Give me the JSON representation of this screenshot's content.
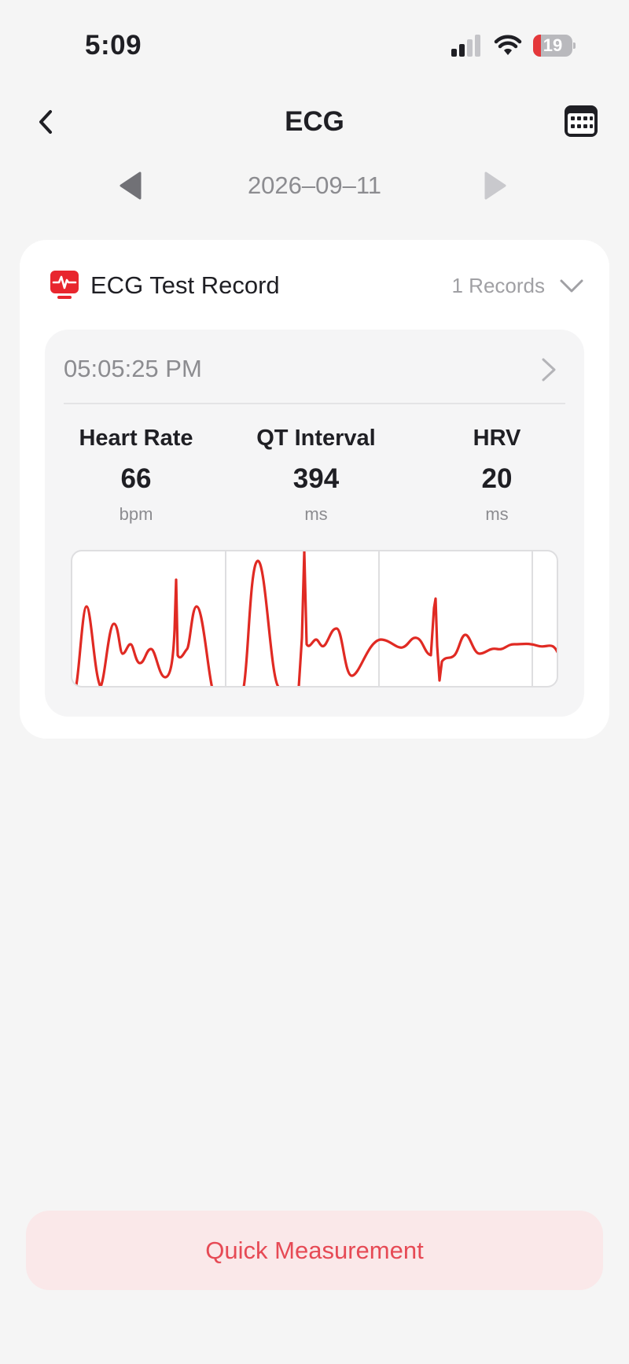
{
  "status_bar": {
    "time": "5:09",
    "battery_level": "19",
    "battery_fraction": 0.19,
    "battery_color": "#e5383b"
  },
  "header": {
    "title": "ECG",
    "back_icon": "chevron-left-icon",
    "calendar_icon": "calendar-icon"
  },
  "date_nav": {
    "date": "2026–09–11",
    "prev_icon": "triangle-left-icon",
    "next_icon": "triangle-right-icon"
  },
  "card": {
    "title": "ECG Test Record",
    "records_count": "1 Records",
    "icon": "ecg-monitor-icon",
    "accent_color": "#e8262e",
    "record": {
      "time": "05:05:25 PM",
      "metrics": [
        {
          "label": "Heart Rate",
          "value": "66",
          "unit": "bpm"
        },
        {
          "label": "QT Interval",
          "value": "394",
          "unit": "ms"
        },
        {
          "label": "HRV",
          "value": "20",
          "unit": "ms"
        }
      ],
      "waveform_color": "#e02a23"
    }
  },
  "quick_measure": {
    "label": "Quick Measurement",
    "text_color": "#e64a55",
    "bg_color": "#fae8e9"
  }
}
